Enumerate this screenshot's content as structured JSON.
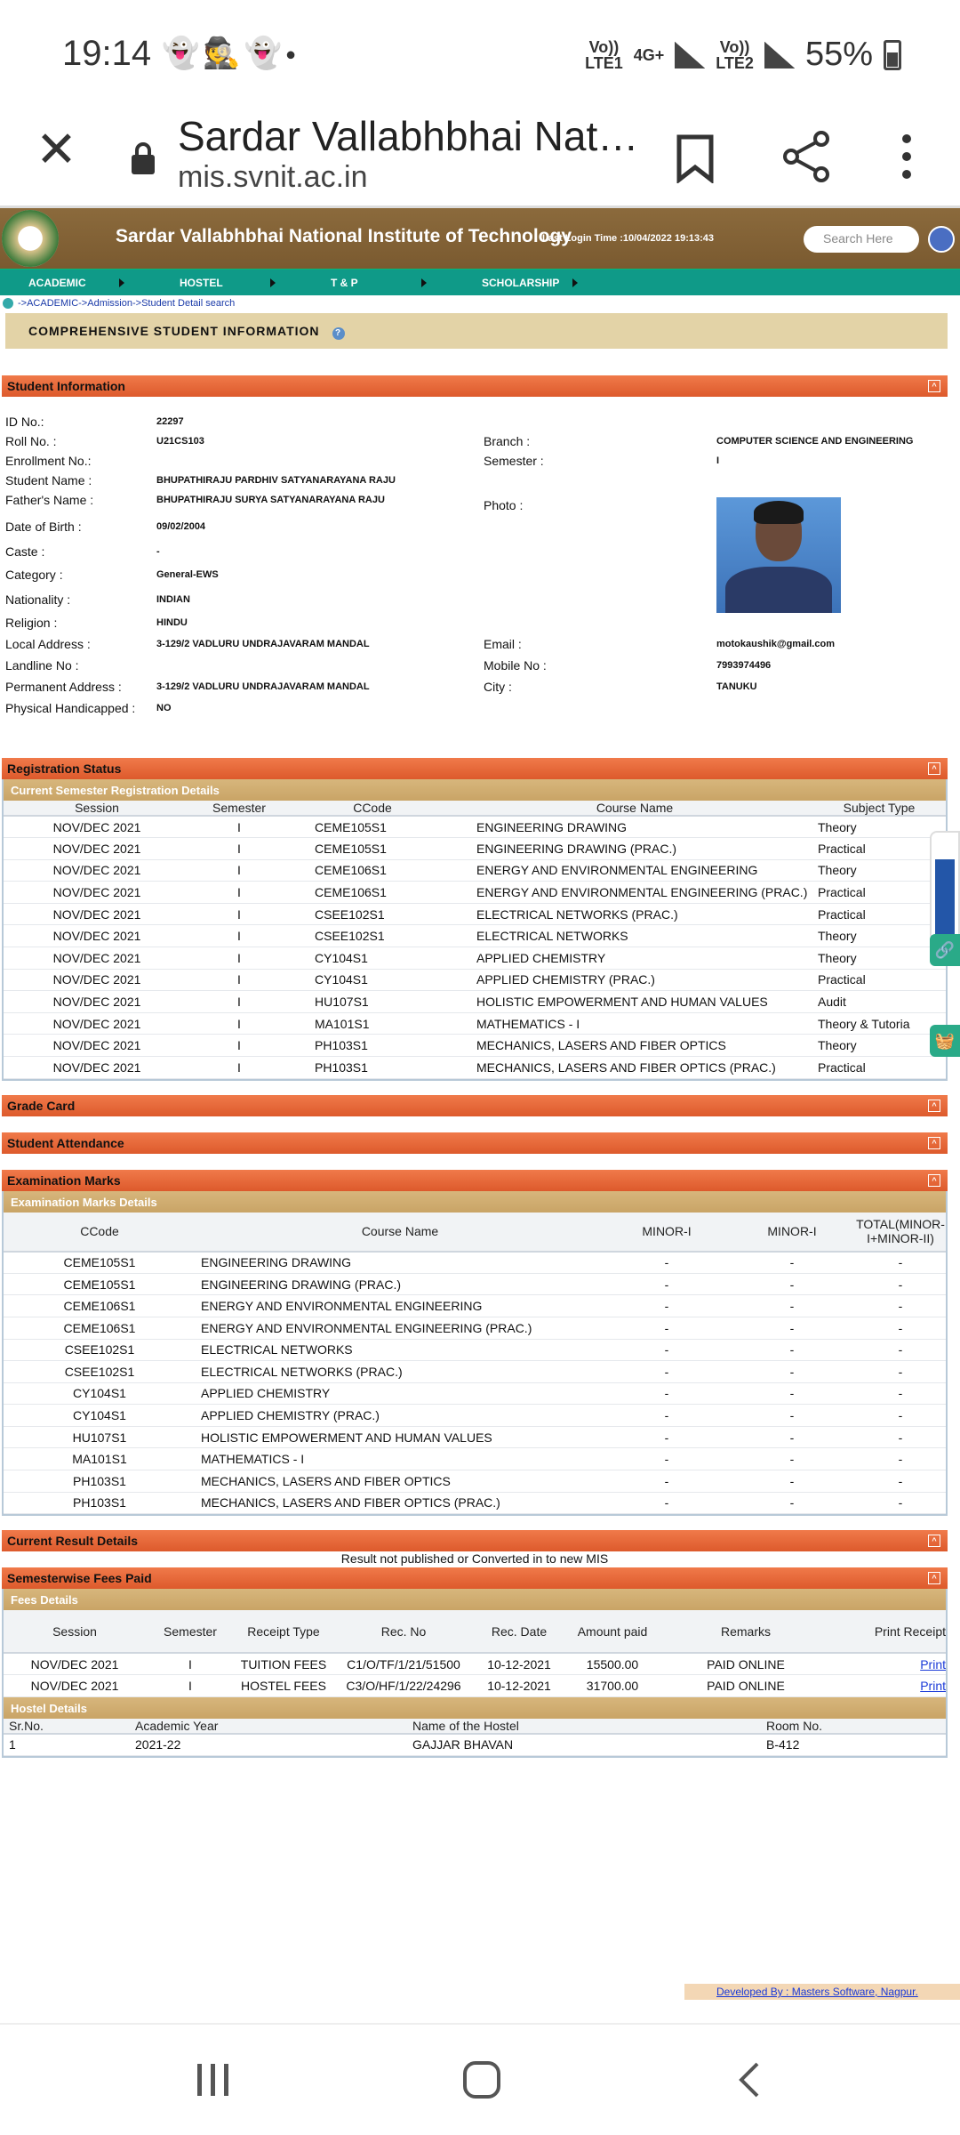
{
  "status_bar": {
    "time": "19:14",
    "notif_icons": [
      "snapchat-icon",
      "incognito-icon",
      "snapchat-icon",
      "dot-icon"
    ],
    "net1_top": "Vo))",
    "net1_bottom": "LTE1",
    "net_type": "4G+",
    "net2_top": "Vo))",
    "net2_bottom": "LTE2",
    "battery": "55%"
  },
  "browser": {
    "title": "Sardar Vallabhbhai Nat…",
    "url": "mis.svnit.ac.in"
  },
  "header": {
    "title": "Sardar Vallabhbhai National Institute of Technology",
    "last_login": "Last Login Time :10/04/2022 19:13:43",
    "search_placeholder": "Search Here"
  },
  "nav": [
    "ACADEMIC",
    "HOSTEL",
    "T & P",
    "SCHOLARSHIP"
  ],
  "breadcrumb": "->ACADEMIC->Admission->Student Detail search",
  "page_title": "COMPREHENSIVE STUDENT INFORMATION",
  "student": {
    "section_title": "Student Information",
    "labels": {
      "id": "ID No.:",
      "roll": "Roll No. :",
      "enroll": "Enrollment No.:",
      "name": "Student Name :",
      "father": "Father's Name :",
      "dob": "Date of Birth :",
      "caste": "Caste :",
      "category": "Category :",
      "nationality": "Nationality :",
      "religion": "Religion :",
      "local_address": "Local Address :",
      "landline": "Landline No :",
      "permanent_address": "Permanent Address :",
      "handicapped": "Physical Handicapped :",
      "branch": "Branch :",
      "semester": "Semester :",
      "photo": "Photo :",
      "email": "Email :",
      "mobile": "Mobile No :",
      "city": "City :"
    },
    "values": {
      "id": "22297",
      "roll": "U21CS103",
      "enroll": "",
      "name": "BHUPATHIRAJU PARDHIV SATYANARAYANA RAJU",
      "father": "BHUPATHIRAJU SURYA SATYANARAYANA RAJU",
      "dob": "09/02/2004",
      "caste": "-",
      "category": "General-EWS",
      "nationality": "INDIAN",
      "religion": "HINDU",
      "local_address": "3-129/2 VADLURU UNDRAJAVARAM MANDAL",
      "landline": "",
      "permanent_address": "3-129/2 VADLURU UNDRAJAVARAM MANDAL",
      "handicapped": "NO",
      "branch": "COMPUTER SCIENCE AND ENGINEERING",
      "semester": "I",
      "email": "motokaushik@gmail.com",
      "mobile": "7993974496",
      "city": "TANUKU"
    }
  },
  "registration": {
    "section_title": "Registration Status",
    "sub_title": "Current Semester Registration Details",
    "headers": [
      "Session",
      "Semester",
      "CCode",
      "Course Name",
      "Subject Type"
    ],
    "rows": [
      [
        "NOV/DEC 2021",
        "I",
        "CEME105S1",
        "ENGINEERING DRAWING",
        "Theory"
      ],
      [
        "NOV/DEC 2021",
        "I",
        "CEME105S1",
        "ENGINEERING DRAWING (PRAC.)",
        "Practical"
      ],
      [
        "NOV/DEC 2021",
        "I",
        "CEME106S1",
        "ENERGY AND ENVIRONMENTAL ENGINEERING",
        "Theory"
      ],
      [
        "NOV/DEC 2021",
        "I",
        "CEME106S1",
        "ENERGY AND ENVIRONMENTAL ENGINEERING (PRAC.)",
        "Practical"
      ],
      [
        "NOV/DEC 2021",
        "I",
        "CSEE102S1",
        "ELECTRICAL NETWORKS (PRAC.)",
        "Practical"
      ],
      [
        "NOV/DEC 2021",
        "I",
        "CSEE102S1",
        "ELECTRICAL NETWORKS",
        "Theory"
      ],
      [
        "NOV/DEC 2021",
        "I",
        "CY104S1",
        "APPLIED CHEMISTRY",
        "Theory"
      ],
      [
        "NOV/DEC 2021",
        "I",
        "CY104S1",
        "APPLIED CHEMISTRY (PRAC.)",
        "Practical"
      ],
      [
        "NOV/DEC 2021",
        "I",
        "HU107S1",
        "HOLISTIC EMPOWERMENT AND HUMAN VALUES",
        "Audit"
      ],
      [
        "NOV/DEC 2021",
        "I",
        "MA101S1",
        "MATHEMATICS - I",
        "Theory & Tutoria"
      ],
      [
        "NOV/DEC 2021",
        "I",
        "PH103S1",
        "MECHANICS, LASERS AND FIBER OPTICS",
        "Theory"
      ],
      [
        "NOV/DEC 2021",
        "I",
        "PH103S1",
        "MECHANICS, LASERS AND FIBER OPTICS (PRAC.)",
        "Practical"
      ]
    ]
  },
  "grade_card": "Grade Card",
  "attendance": "Student Attendance",
  "exam": {
    "section_title": "Examination Marks",
    "sub_title": "Examination Marks Details",
    "headers": [
      "CCode",
      "Course Name",
      "MINOR-I",
      "MINOR-I",
      "TOTAL(MINOR-I+MINOR-II)"
    ],
    "rows": [
      [
        "CEME105S1",
        "ENGINEERING DRAWING",
        "-",
        "-",
        "-"
      ],
      [
        "CEME105S1",
        "ENGINEERING DRAWING (PRAC.)",
        "-",
        "-",
        "-"
      ],
      [
        "CEME106S1",
        "ENERGY AND ENVIRONMENTAL ENGINEERING",
        "-",
        "-",
        "-"
      ],
      [
        "CEME106S1",
        "ENERGY AND ENVIRONMENTAL ENGINEERING (PRAC.)",
        "-",
        "-",
        "-"
      ],
      [
        "CSEE102S1",
        "ELECTRICAL NETWORKS",
        "-",
        "-",
        "-"
      ],
      [
        "CSEE102S1",
        "ELECTRICAL NETWORKS (PRAC.)",
        "-",
        "-",
        "-"
      ],
      [
        "CY104S1",
        "APPLIED CHEMISTRY",
        "-",
        "-",
        "-"
      ],
      [
        "CY104S1",
        "APPLIED CHEMISTRY (PRAC.)",
        "-",
        "-",
        "-"
      ],
      [
        "HU107S1",
        "HOLISTIC EMPOWERMENT AND HUMAN VALUES",
        "-",
        "-",
        "-"
      ],
      [
        "MA101S1",
        "MATHEMATICS - I",
        "-",
        "-",
        "-"
      ],
      [
        "PH103S1",
        "MECHANICS, LASERS AND FIBER OPTICS",
        "-",
        "-",
        "-"
      ],
      [
        "PH103S1",
        "MECHANICS, LASERS AND FIBER OPTICS (PRAC.)",
        "-",
        "-",
        "-"
      ]
    ]
  },
  "result": {
    "section_title": "Current Result Details",
    "message": "Result not published or Converted in to new MIS"
  },
  "fees": {
    "section_title": "Semesterwise Fees Paid",
    "sub_title": "Fees Details",
    "headers": [
      "Session",
      "Semester",
      "Receipt Type",
      "Rec. No",
      "Rec. Date",
      "Amount paid",
      "Remarks",
      "Print Receipt"
    ],
    "rows": [
      [
        "NOV/DEC 2021",
        "I",
        "TUITION FEES",
        "C1/O/TF/1/21/51500",
        "10-12-2021",
        "15500.00",
        "PAID ONLINE",
        "Print"
      ],
      [
        "NOV/DEC 2021",
        "I",
        "HOSTEL FEES",
        "C3/O/HF/1/22/24296",
        "10-12-2021",
        "31700.00",
        "PAID ONLINE",
        "Print"
      ]
    ]
  },
  "hostel": {
    "sub_title": "Hostel Details",
    "headers": [
      "Sr.No.",
      "Academic Year",
      "Name of the Hostel",
      "Room No."
    ],
    "rows": [
      [
        "1",
        "2021-22",
        "GAJJAR BHAVAN",
        "B-412"
      ]
    ]
  },
  "footer": "Developed By : Masters Software, Nagpur."
}
